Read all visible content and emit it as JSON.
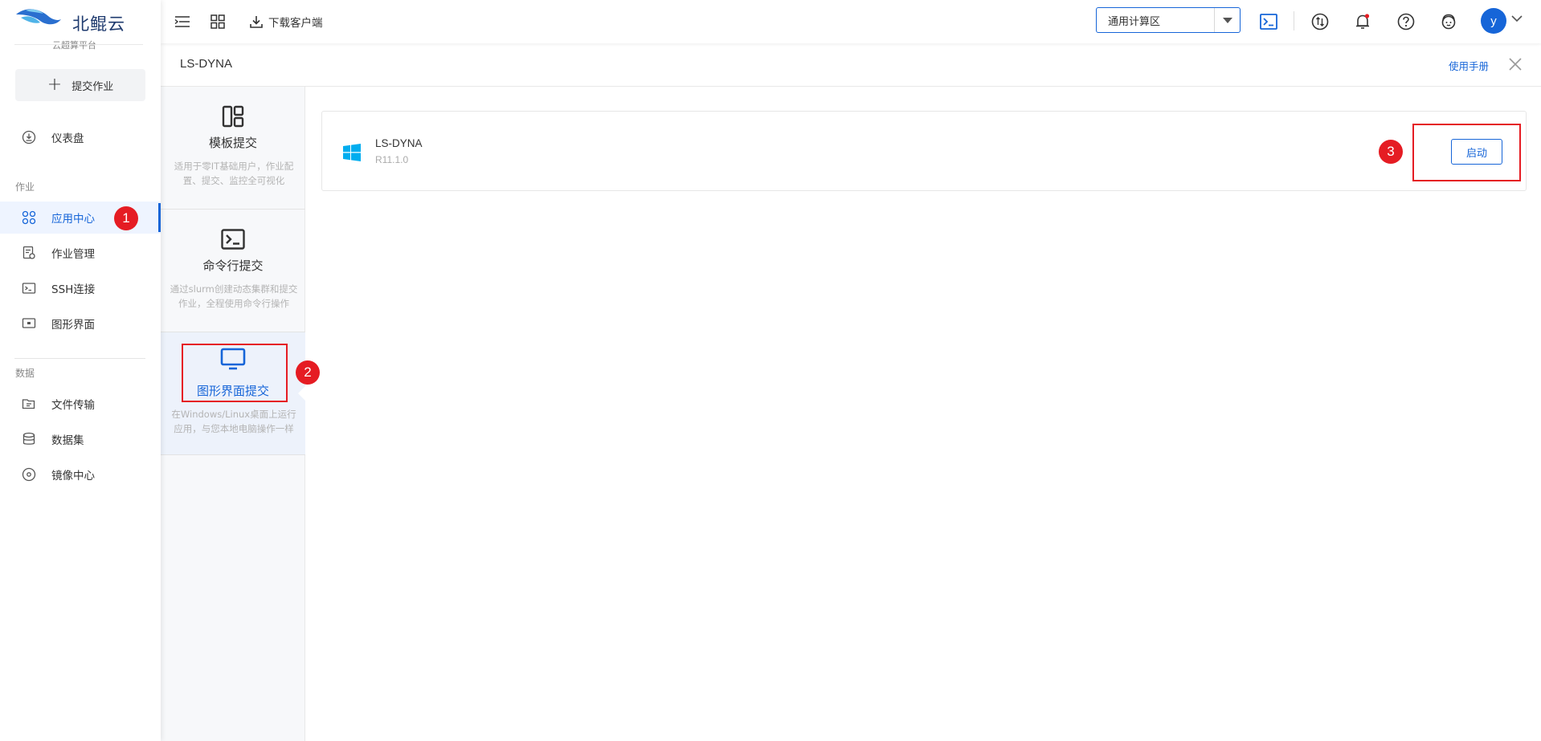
{
  "brand": {
    "name": "北鲲云",
    "subtitle": "云超算平台"
  },
  "sidebar": {
    "submit_job_label": "提交作业",
    "dashboard_label": "仪表盘",
    "section_job": "作业",
    "section_data": "数据",
    "job_items": [
      {
        "label": "应用中心",
        "icon": "apps-grid-icon",
        "active": true
      },
      {
        "label": "作业管理",
        "icon": "job-list-icon",
        "active": false
      },
      {
        "label": "SSH连接",
        "icon": "terminal-icon",
        "active": false
      },
      {
        "label": "图形界面",
        "icon": "desktop-icon",
        "active": false
      }
    ],
    "data_items": [
      {
        "label": "文件传输",
        "icon": "folder-transfer-icon"
      },
      {
        "label": "数据集",
        "icon": "database-icon"
      },
      {
        "label": "镜像中心",
        "icon": "disc-icon"
      }
    ]
  },
  "topbar": {
    "download_label": "下载客户端",
    "zone_selected": "通用计算区",
    "avatar_initial": "y"
  },
  "page": {
    "title": "LS-DYNA",
    "manual_link": "使用手册"
  },
  "submit_types": [
    {
      "title": "模板提交",
      "desc": "适用于零IT基础用户，作业配置、提交、监控全可视化",
      "active": false
    },
    {
      "title": "命令行提交",
      "desc": "通过slurm创建动态集群和提交 作业，全程使用命令行操作",
      "active": false
    },
    {
      "title": "图形界面提交",
      "desc": "在Windows/Linux桌面上运行应用，与您本地电脑操作一样",
      "active": true
    }
  ],
  "apps": [
    {
      "name": "LS-DYNA",
      "version": "R11.1.0",
      "os": "windows",
      "action_label": "启动"
    }
  ],
  "annotations": {
    "step1": "1",
    "step2": "2",
    "step3": "3"
  },
  "colors": {
    "primary": "#1665d8",
    "highlight": "#e51c23",
    "windows_icon": "#00adef"
  }
}
